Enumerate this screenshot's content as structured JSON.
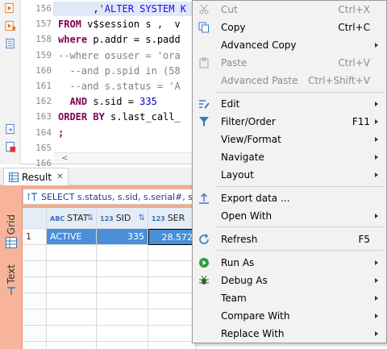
{
  "editor": {
    "line_numbers": [
      "156",
      "157",
      "158",
      "159",
      "160",
      "161",
      "162",
      "163",
      "164",
      "165",
      "166"
    ],
    "code_lines": [
      [
        {
          "t": "      ,",
          "c": ""
        },
        {
          "t": "'ALTER SYSTEM K",
          "c": "str"
        }
      ],
      [
        {
          "t": "FROM",
          "c": "kw"
        },
        {
          "t": " v$session s ,  v",
          "c": ""
        }
      ],
      [
        {
          "t": "where",
          "c": "kw"
        },
        {
          "t": " p.addr = s.padd",
          "c": ""
        }
      ],
      [
        {
          "t": "--where osuser = 'ora",
          "c": "cmt"
        }
      ],
      [
        {
          "t": "  --and p.spid in (58",
          "c": "cmt"
        }
      ],
      [
        {
          "t": "  --and s.status = 'A",
          "c": "cmt"
        }
      ],
      [
        {
          "t": "  AND",
          "c": "kw"
        },
        {
          "t": " s.sid = ",
          "c": ""
        },
        {
          "t": "335",
          "c": "num"
        }
      ],
      [
        {
          "t": "ORDER BY",
          "c": "kw"
        },
        {
          "t": " s.last_call_",
          "c": ""
        }
      ],
      [
        {
          "t": ";",
          "c": "kw"
        }
      ],
      [
        {
          "t": "",
          "c": ""
        }
      ],
      [
        {
          "t": "",
          "c": ""
        }
      ]
    ],
    "scroll_left_glyph": "<"
  },
  "result": {
    "tab_label": "Result",
    "tab_close": "✕",
    "side_tabs": [
      "Grid",
      "Text"
    ],
    "filter_text": "SELECT s.status, s.sid, s.serial#, s.p",
    "columns": [
      {
        "type": "ABC",
        "name": "STAT"
      },
      {
        "type": "123",
        "name": "SID"
      },
      {
        "type": "123",
        "name": "SER"
      }
    ],
    "rows": [
      {
        "num": "1",
        "cells": [
          "ACTIVE",
          "335",
          "28.572"
        ]
      }
    ]
  },
  "menu": {
    "items": [
      {
        "key": "cut",
        "label": "Cut",
        "shortcut": "Ctrl+X",
        "disabled": true,
        "submenu": false,
        "icon": "scissors-icon"
      },
      {
        "key": "copy",
        "label": "Copy",
        "shortcut": "Ctrl+C",
        "disabled": false,
        "submenu": false,
        "icon": "copy-icon"
      },
      {
        "key": "advanced-copy",
        "label": "Advanced Copy",
        "shortcut": "",
        "disabled": false,
        "submenu": true,
        "icon": ""
      },
      {
        "key": "paste",
        "label": "Paste",
        "shortcut": "Ctrl+V",
        "disabled": true,
        "submenu": false,
        "icon": "clipboard-icon"
      },
      {
        "key": "advanced-paste",
        "label": "Advanced Paste",
        "shortcut": "Ctrl+Shift+V",
        "disabled": true,
        "submenu": false,
        "icon": ""
      },
      {
        "key": "edit",
        "label": "Edit",
        "shortcut": "",
        "disabled": false,
        "submenu": true,
        "icon": "edit-icon"
      },
      {
        "key": "filter-order",
        "label": "Filter/Order",
        "shortcut": "F11",
        "disabled": false,
        "submenu": true,
        "icon": "filter-icon"
      },
      {
        "key": "view-format",
        "label": "View/Format",
        "shortcut": "",
        "disabled": false,
        "submenu": true,
        "icon": ""
      },
      {
        "key": "navigate",
        "label": "Navigate",
        "shortcut": "",
        "disabled": false,
        "submenu": true,
        "icon": ""
      },
      {
        "key": "layout",
        "label": "Layout",
        "shortcut": "",
        "disabled": false,
        "submenu": true,
        "icon": ""
      },
      {
        "key": "export-data",
        "label": "Export data ...",
        "shortcut": "",
        "disabled": false,
        "submenu": false,
        "icon": "export-icon"
      },
      {
        "key": "open-with",
        "label": "Open With",
        "shortcut": "",
        "disabled": false,
        "submenu": true,
        "icon": ""
      },
      {
        "key": "refresh",
        "label": "Refresh",
        "shortcut": "F5",
        "disabled": false,
        "submenu": false,
        "icon": "refresh-icon"
      },
      {
        "key": "run-as",
        "label": "Run As",
        "shortcut": "",
        "disabled": false,
        "submenu": true,
        "icon": "run-icon"
      },
      {
        "key": "debug-as",
        "label": "Debug As",
        "shortcut": "",
        "disabled": false,
        "submenu": true,
        "icon": "bug-icon"
      },
      {
        "key": "team",
        "label": "Team",
        "shortcut": "",
        "disabled": false,
        "submenu": true,
        "icon": ""
      },
      {
        "key": "compare-with",
        "label": "Compare With",
        "shortcut": "",
        "disabled": false,
        "submenu": true,
        "icon": ""
      },
      {
        "key": "replace-with",
        "label": "Replace With",
        "shortcut": "",
        "disabled": false,
        "submenu": true,
        "icon": ""
      }
    ]
  },
  "colors": {
    "result_background": "#f7a98a",
    "selected_cell": "#4a90d9",
    "menu_background": "#f2f2f2"
  }
}
